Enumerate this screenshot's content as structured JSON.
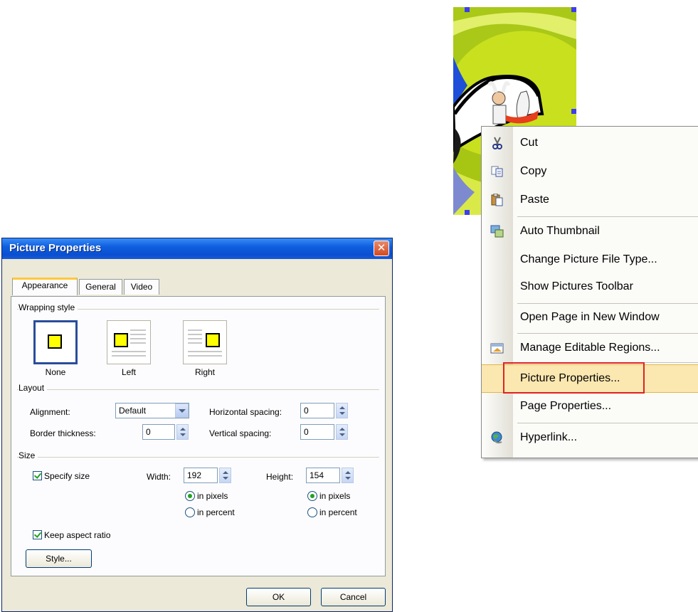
{
  "context_menu": {
    "items": [
      {
        "label": "Cut",
        "icon": "scissors-icon"
      },
      {
        "label": "Copy",
        "icon": "copy-icon"
      },
      {
        "label": "Paste",
        "icon": "paste-icon"
      },
      {
        "label": "Auto Thumbnail",
        "icon": "thumbnail-icon"
      },
      {
        "label": "Change Picture File Type..."
      },
      {
        "label": "Show Pictures Toolbar"
      },
      {
        "label": "Open Page in New Window"
      },
      {
        "label": "Manage Editable Regions...",
        "icon": "regions-icon"
      },
      {
        "label": "Picture Properties..."
      },
      {
        "label": "Page Properties..."
      },
      {
        "label": "Hyperlink...",
        "icon": "hyperlink-icon"
      }
    ],
    "highlighted_index": 8,
    "highlight_color": "#fbe7b0",
    "annotation_color": "#e02222"
  },
  "dialog": {
    "title": "Picture Properties",
    "tabs": [
      {
        "label": "Appearance"
      },
      {
        "label": "General"
      },
      {
        "label": "Video"
      }
    ],
    "active_tab": "Appearance",
    "wrapping": {
      "label": "Wrapping style",
      "options": [
        "None",
        "Left",
        "Right"
      ],
      "selected": "None"
    },
    "layout": {
      "label": "Layout",
      "alignment_label": "Alignment:",
      "alignment_value": "Default",
      "border_label": "Border thickness:",
      "border_value": "0",
      "hspacing_label": "Horizontal spacing:",
      "hspacing_value": "0",
      "vspacing_label": "Vertical spacing:",
      "vspacing_value": "0"
    },
    "size": {
      "label": "Size",
      "specify_label": "Specify size",
      "specify_checked": true,
      "width_label": "Width:",
      "width_value": "192",
      "height_label": "Height:",
      "height_value": "154",
      "pixels_label": "in pixels",
      "percent_label": "in percent",
      "keep_aspect_label": "Keep aspect ratio",
      "keep_aspect_checked": true
    },
    "style_button": "Style...",
    "ok_button": "OK",
    "cancel_button": "Cancel"
  }
}
